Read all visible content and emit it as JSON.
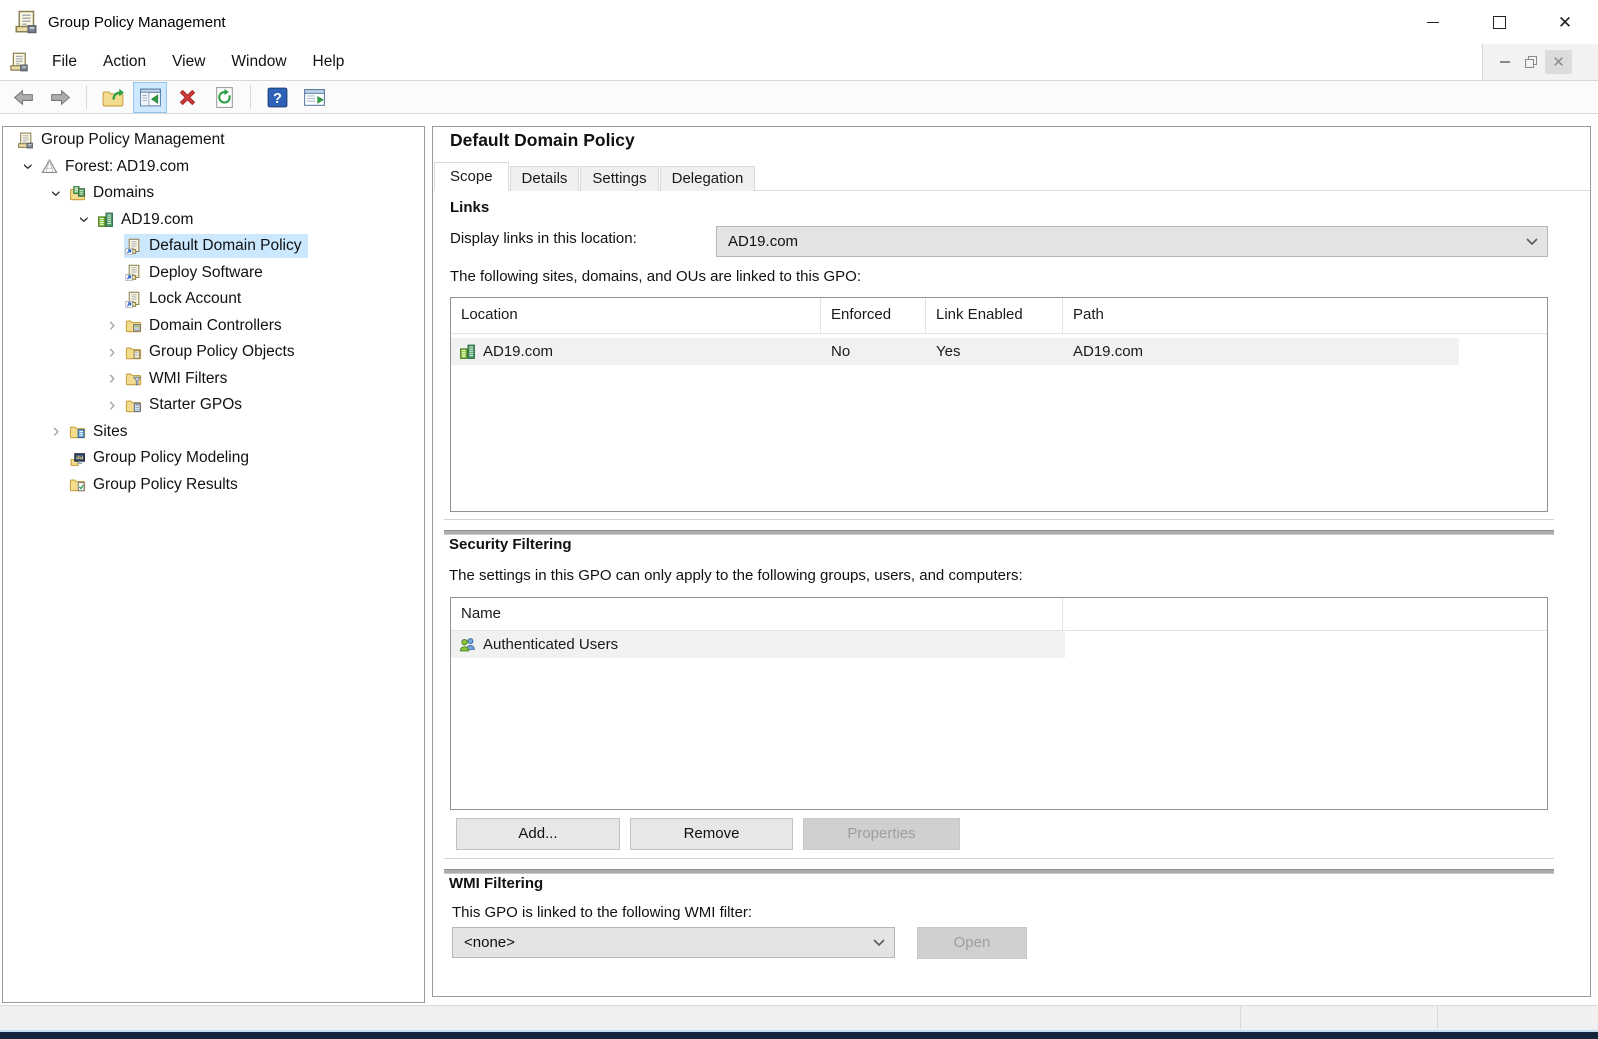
{
  "window": {
    "title": "Group Policy Management",
    "controls": [
      "minimize",
      "maximize",
      "close"
    ],
    "mdi_controls": [
      "minimize",
      "restore",
      "close"
    ]
  },
  "menu": {
    "items": [
      "File",
      "Action",
      "View",
      "Window",
      "Help"
    ]
  },
  "toolbar": {
    "buttons": [
      {
        "name": "back"
      },
      {
        "name": "forward"
      },
      {
        "name": "separator"
      },
      {
        "name": "export-list"
      },
      {
        "name": "toggle-console-tree",
        "active": true
      },
      {
        "name": "delete"
      },
      {
        "name": "refresh"
      },
      {
        "name": "separator"
      },
      {
        "name": "help"
      },
      {
        "name": "new-window"
      }
    ]
  },
  "tree": {
    "items": [
      {
        "label": "Group Policy Management",
        "icon": "gpmc",
        "indent": 13,
        "chevron": "omit",
        "selected": false
      },
      {
        "label": "Forest: AD19.com",
        "icon": "forest",
        "indent": 13,
        "chevron": "expanded",
        "selected": false
      },
      {
        "label": "Domains",
        "icon": "domains",
        "indent": 41,
        "chevron": "expanded",
        "selected": false
      },
      {
        "label": "AD19.com",
        "icon": "domain",
        "indent": 69,
        "chevron": "expanded",
        "selected": false
      },
      {
        "label": "Default Domain Policy",
        "icon": "gpo-link",
        "indent": 97,
        "chevron": "blank",
        "selected": true
      },
      {
        "label": "Deploy Software",
        "icon": "gpo-link",
        "indent": 97,
        "chevron": "blank",
        "selected": false
      },
      {
        "label": "Lock Account",
        "icon": "gpo-link",
        "indent": 97,
        "chevron": "blank",
        "selected": false
      },
      {
        "label": "Domain Controllers",
        "icon": "folder-dc",
        "indent": 97,
        "chevron": "collapsed",
        "selected": false
      },
      {
        "label": "Group Policy Objects",
        "icon": "folder-gpo",
        "indent": 97,
        "chevron": "collapsed",
        "selected": false
      },
      {
        "label": "WMI Filters",
        "icon": "folder-wmi",
        "indent": 97,
        "chevron": "collapsed",
        "selected": false
      },
      {
        "label": "Starter GPOs",
        "icon": "folder-starter",
        "indent": 97,
        "chevron": "collapsed",
        "selected": false
      },
      {
        "label": "Sites",
        "icon": "folder-sites",
        "indent": 41,
        "chevron": "collapsed",
        "selected": false
      },
      {
        "label": "Group Policy Modeling",
        "icon": "modeling",
        "indent": 41,
        "chevron": "blank",
        "selected": false
      },
      {
        "label": "Group Policy Results",
        "icon": "folder-results",
        "indent": 41,
        "chevron": "blank",
        "selected": false
      }
    ]
  },
  "content": {
    "title": "Default Domain Policy",
    "tabs": [
      {
        "label": "Scope",
        "active": true
      },
      {
        "label": "Details",
        "active": false
      },
      {
        "label": "Settings",
        "active": false
      },
      {
        "label": "Delegation",
        "active": false
      }
    ],
    "links": {
      "heading": "Links",
      "display_label": "Display links in this location:",
      "location_value": "AD19.com",
      "caption": "The following sites, domains, and OUs are linked to this GPO:",
      "columns": [
        "Location",
        "Enforced",
        "Link Enabled",
        "Path"
      ],
      "rows": [
        {
          "location": "AD19.com",
          "enforced": "No",
          "link_enabled": "Yes",
          "path": "AD19.com"
        }
      ]
    },
    "security_filtering": {
      "heading": "Security Filtering",
      "description": "The settings in this GPO can only apply to the following groups, users, and computers:",
      "column": "Name",
      "rows": [
        {
          "name": "Authenticated Users"
        }
      ],
      "buttons": {
        "add": "Add...",
        "remove": "Remove",
        "properties": "Properties"
      }
    },
    "wmi_filtering": {
      "heading": "WMI Filtering",
      "description": "This GPO is linked to the following WMI filter:",
      "value": "<none>",
      "open_label": "Open"
    }
  },
  "colors": {
    "selection": "#cce8ff",
    "row_highlight": "#f1f1f1",
    "toolbar_active": "#cde8ff",
    "disabled_text": "#9e9e9e",
    "bottom_bar": "#14233c"
  }
}
